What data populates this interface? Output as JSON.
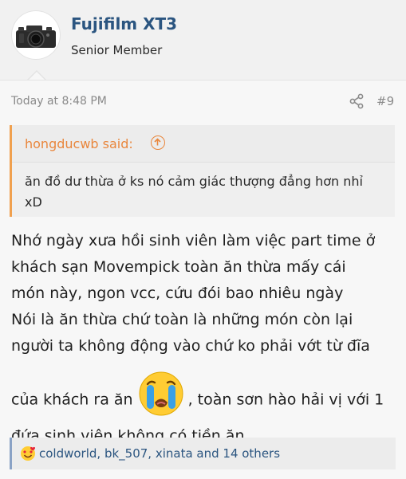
{
  "user": {
    "name": "Fujifilm XT3",
    "title": "Senior Member",
    "avatar_icon": "camera-icon"
  },
  "post": {
    "time": "Today at 8:48 PM",
    "number": "#9",
    "share_icon": "share-icon",
    "quote": {
      "author": "hongducwb said:",
      "text": "ăn đồ dư thừa ở ks nó cảm giác thượng đẳng hơn nhỉ xD"
    },
    "body_lines": [
      "Nhớ ngày xưa hồi sinh viên làm việc part time ở",
      "khách sạn Movempick toàn ăn thừa mấy cái",
      "món này, ngon vcc, cứu đói bao nhiêu ngày",
      "Nói là ăn thừa chứ toàn là những món còn lại",
      "người ta không động vào chứ ko phải vớt từ đĩa"
    ],
    "body_emoji_before": "của khách ra ăn",
    "body_emoji_icon": "crying-face-icon",
    "body_emoji_after": ", toàn sơn hào hải vị với 1",
    "body_last": "đứa sinh viên không có tiền ăn",
    "reactions": {
      "icon": "love-reaction-icon",
      "text": "coldworld, bk_507, xinata and 14 others"
    }
  },
  "colors": {
    "username": "#2b5580",
    "quote_accent": "#e9863c",
    "reaction_accent": "#8aa2c5"
  }
}
